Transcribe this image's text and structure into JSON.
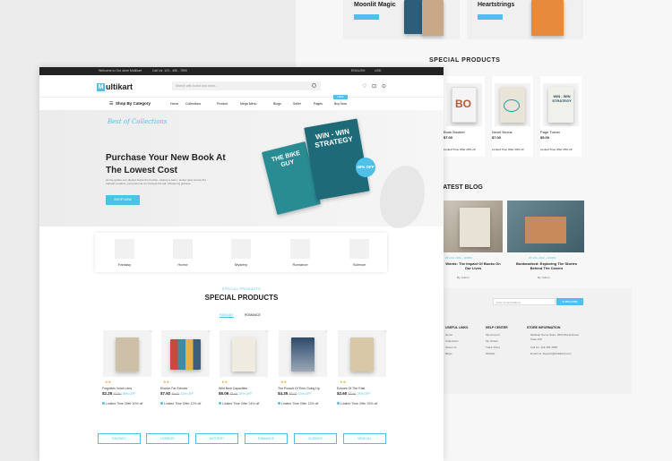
{
  "banner_top": {
    "item1": "Moonlit Magic",
    "item2": "Heartstrings"
  },
  "right_page": {
    "special_title": "SPECIAL PRODUCTS",
    "products": [
      {
        "name": "Book Booklet",
        "price": "$7.00",
        "offer": "Limited Time Offer 20% off"
      },
      {
        "name": "Novel Nexus",
        "price": "$7.00",
        "offer": "Limited Time Offer 20% off"
      },
      {
        "name": "Page Turner",
        "price": "$5.00",
        "offer": "Limited Time Offer 25% off"
      }
    ],
    "blog_title": "LATEST BLOG",
    "blogs": [
      {
        "date": "05 AUG 2024 - ADMIN",
        "title": "Words: The Impact Of Books On Our Lives",
        "by": "By: Admin"
      },
      {
        "date": "05 AUG 2024 - ADMIN",
        "title": "Bookmarked: Exploring The Stories Behind The Covers",
        "by": "By: Admin"
      }
    ],
    "newsletter_placeholder": "Enter Email Address",
    "subscribe": "SUBSCRIBE",
    "footer": {
      "useful_links": "USEFUL LINKS",
      "useful_items": [
        "Home",
        "Collections",
        "About Us",
        "Blogs"
      ],
      "help_center": "HELP CENTER",
      "help_items": [
        "My Account",
        "My Orders",
        "Track Order",
        "Wishlist"
      ],
      "store_info": "STORE INFORMATION",
      "store_items": [
        "Multikart Demo Store, 3654 Brand Road, Suite 209",
        "Call Us: 123-456-7898",
        "Email Us: Support@Multikart.Com"
      ]
    }
  },
  "topbar": {
    "welcome": "Welcome to Our store Multikart",
    "phone": "Call Us: 123 - 456 - 7890",
    "language": "ENGLISH",
    "currency": "USD"
  },
  "header": {
    "logo": "ultikart",
    "search_placeholder": "Search with brand and more...",
    "category": "Shop By Category",
    "nav": [
      "Home",
      "Collections",
      "Product",
      "Mega Menu",
      "Blogs",
      "Seller",
      "Pages",
      "Buy Now"
    ],
    "new_badge": "NEW"
  },
  "hero": {
    "script": "Best of Collections",
    "title_line1": "Purchase Your New Book At",
    "title_line2": "The Lowest Cost",
    "desc": "As the golden sun dipped below the horizon, casting a warm, amber glow across the tranquil meadow, young Emma ran through the tall, whispering grasses.",
    "cta": "SHOP NOW",
    "book1": "THE BIKE GUY",
    "book2": "WIN - WIN STRATEGY",
    "badge": "40% OFF"
  },
  "categories": [
    "Fantasy",
    "Horror",
    "Mystery",
    "Romance",
    "Science"
  ],
  "special": {
    "subtitle": "SPECIAL PRODUCTS",
    "title": "SPECIAL PRODUCTS",
    "tabs": [
      "FANTASY",
      "ROMANCE"
    ],
    "products": [
      {
        "name": "Forgotten Voice Lens",
        "price": "$2.25",
        "old": "$3.50",
        "off": "35% OFF",
        "offer": "Limited Time Offer 30% off"
      },
      {
        "name": "Elusive Far Echoes",
        "price": "$7.92",
        "old": "$9.00",
        "off": "12% OFF",
        "offer": "Limited Time Offer 12% off"
      },
      {
        "name": "Wild New Capacities",
        "price": "$6.06",
        "old": "$8.00",
        "off": "24% OFF",
        "offer": "Limited Time Offer 24% off"
      },
      {
        "name": "The Pursuit Of Time Going Up",
        "price": "$4.35",
        "old": "$5.00",
        "off": "13% OFF",
        "offer": "Limited Time Offer 13% off"
      },
      {
        "name": "Echoes Of The Past",
        "price": "$2.60",
        "old": "$3.50",
        "off": "25% OFF",
        "offer": "Limited Time Offer 25% off"
      }
    ]
  },
  "bottom_buttons": [
    "FANTASY",
    "HORROR",
    "MYSTERY",
    "ROMANCE",
    "SCIENCE",
    "VIEW ALL"
  ],
  "colors": {
    "accent": "#4fc1e9",
    "dark": "#222222",
    "teal": "#2d9aa8"
  }
}
